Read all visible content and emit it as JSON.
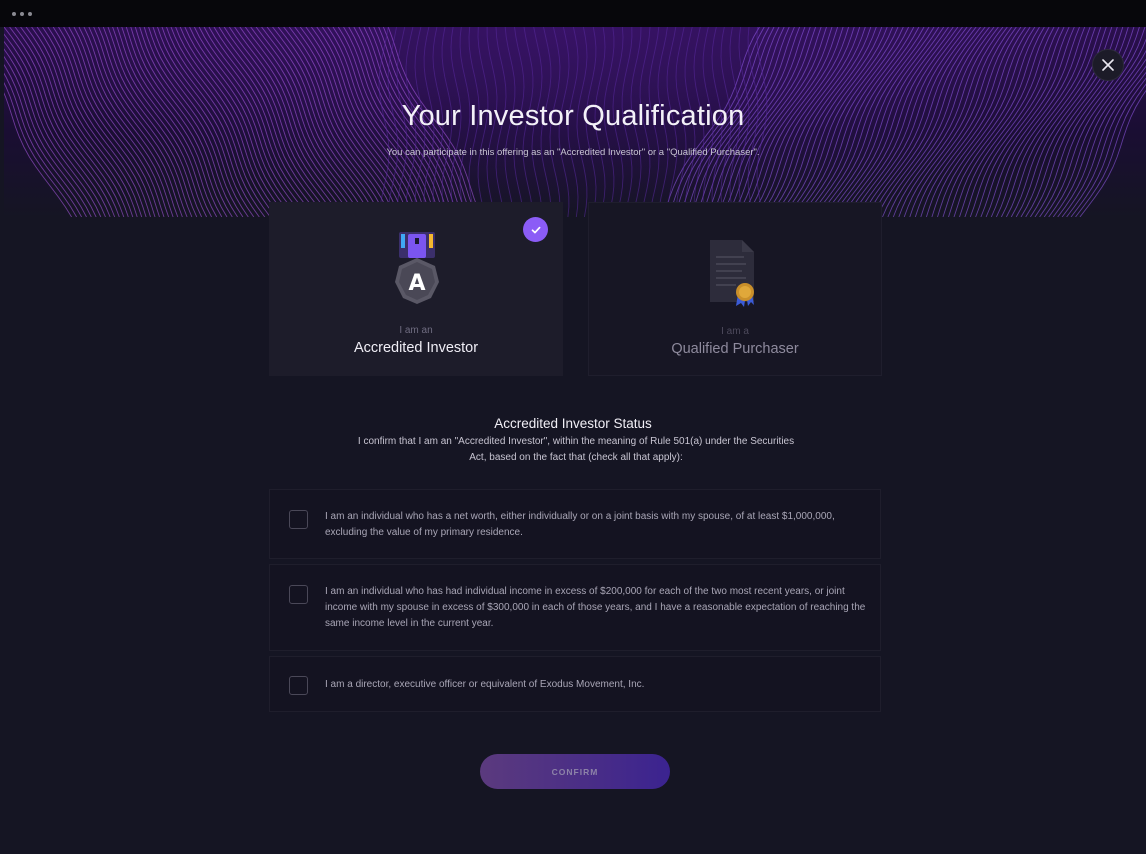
{
  "modal": {
    "title": "Your Investor Qualification",
    "subtitle": "You can participate in this offering as an \"Accredited Investor\" or a \"Qualified Purchaser\"."
  },
  "cards": [
    {
      "pre_label": "I am an",
      "label": "Accredited Investor",
      "selected": true,
      "icon": "accredited-badge-icon"
    },
    {
      "pre_label": "I am a",
      "label": "Qualified Purchaser",
      "selected": false,
      "icon": "certificate-document-icon"
    }
  ],
  "status": {
    "title": "Accredited Investor Status",
    "description": "I confirm that I am an \"Accredited Investor\", within the meaning of Rule 501(a) under the Securities Act, based on the fact that (check all that apply):"
  },
  "options": [
    {
      "text": "I am an individual who has a net worth, either individually or on a joint basis with my spouse, of at least $1,000,000, excluding the value of my primary residence.",
      "checked": false
    },
    {
      "text": "I am an individual who has had individual income in excess of $200,000 for each of the two most recent years, or joint income with my spouse in excess of $300,000 in each of those years, and I have a reasonable expectation of reaching the same income level in the current year.",
      "checked": false
    },
    {
      "text": "I am a director, executive officer or equivalent of Exodus Movement, Inc.",
      "checked": false
    }
  ],
  "confirm_label": "CONFIRM",
  "colors": {
    "accent": "#8b5cf6",
    "background": "#151523",
    "hero_purple": "#2a0f4d"
  }
}
